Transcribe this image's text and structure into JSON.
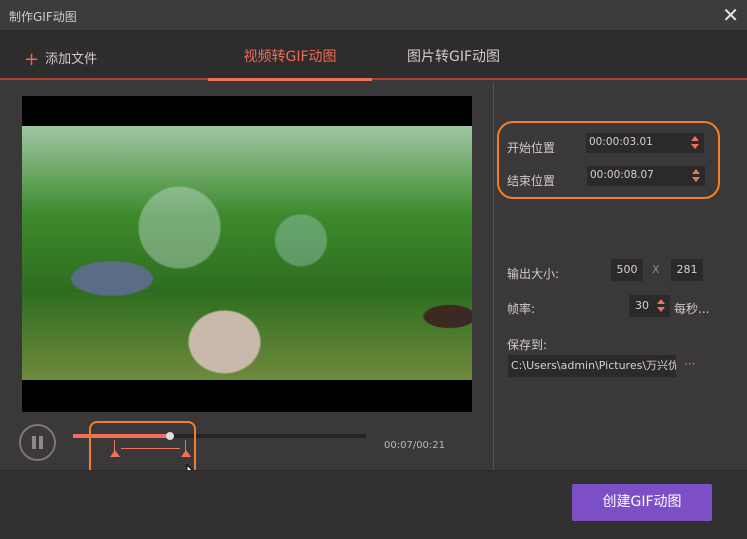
{
  "window": {
    "title": "制作GIF动图",
    "close_icon": "close-icon"
  },
  "toolbar": {
    "add_file": "添加文件",
    "tabs": [
      {
        "label": "视频转GIF动图",
        "active": true
      },
      {
        "label": "图片转GIF动图",
        "active": false
      }
    ]
  },
  "player": {
    "time": "00:07/00:21",
    "progress": 0.33,
    "range_start": 0.143,
    "range_end": 0.384
  },
  "settings": {
    "start_label": "开始位置",
    "start_value": "00:00:03.01",
    "end_label": "结束位置",
    "end_value": "00:00:08.07",
    "size_label": "输出大小:",
    "width": "500",
    "x": "X",
    "height": "281",
    "fps_label": "帧率:",
    "fps": "30",
    "fps_unit": "每秒...",
    "save_label": "保存到:",
    "save_path": "C:\\Users\\admin\\Pictures\\万兴优",
    "more": "···"
  },
  "footer": {
    "create_button": "创建GIF动图"
  },
  "colors": {
    "accent": "#f0705a",
    "highlight": "#f27f2a",
    "button": "#7c4fc6"
  }
}
